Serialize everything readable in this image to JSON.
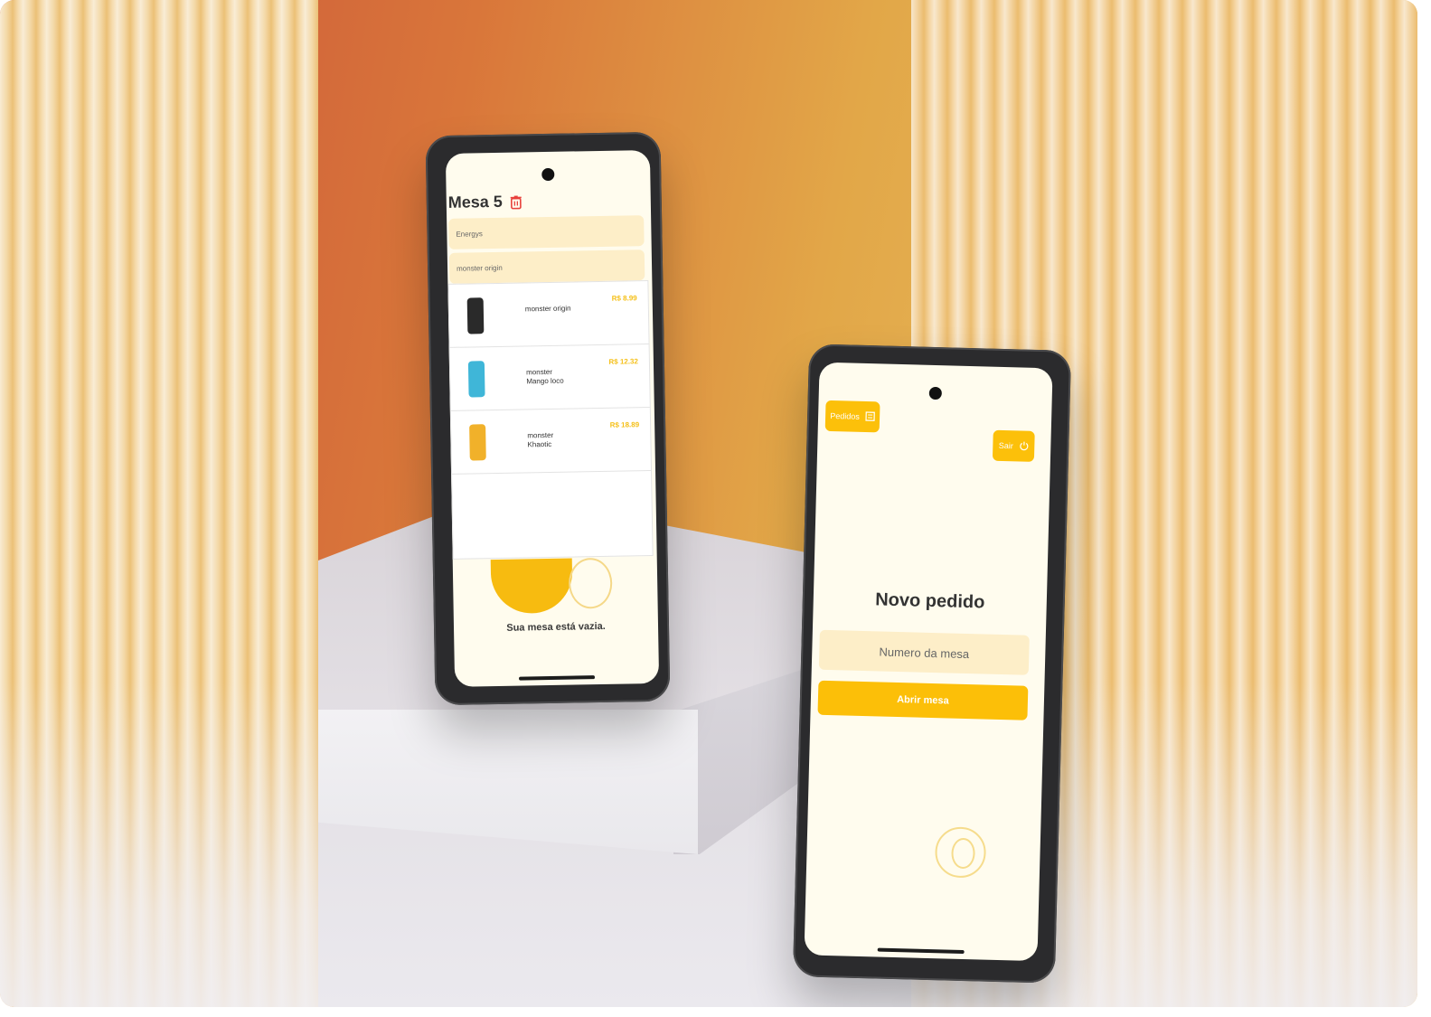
{
  "phone_a": {
    "title": "Mesa 5",
    "category_field": "Energys",
    "search_field": "monster origin",
    "products": [
      {
        "name": "monster origin",
        "price": "R$ 8.99",
        "color": "#2a2a2a"
      },
      {
        "name": "monster\nMango loco",
        "price": "R$ 12.32",
        "color": "#3fb6d8"
      },
      {
        "name": "monster\nKhaotic",
        "price": "R$ 18.89",
        "color": "#f1b12a"
      }
    ],
    "empty_message": "Sua mesa está vazia."
  },
  "phone_b": {
    "orders_button": "Pedidos",
    "exit_button": "Sair",
    "title": "Novo pedido",
    "table_input_placeholder": "Numero da mesa",
    "open_button": "Abrir mesa"
  },
  "colors": {
    "accent": "#fcc00a",
    "field_bg": "#fdeec8",
    "screen_bg": "#fffcee",
    "delete": "#e8413c"
  }
}
